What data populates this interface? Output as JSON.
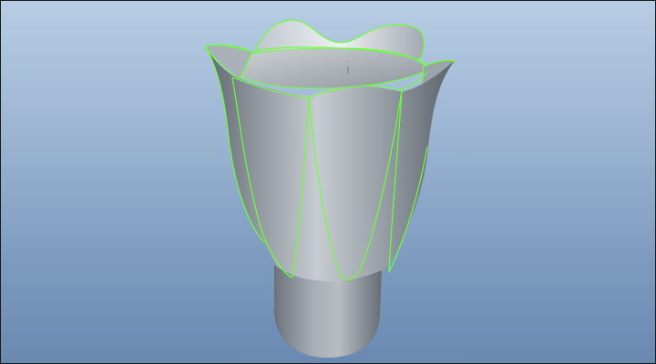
{
  "viewport": {
    "background_top": "#b7cde4",
    "background_bottom": "#6a89b1",
    "model": {
      "shape": "tulip-vase",
      "surface_color": "#9aa3ab",
      "edge_highlight_color": "#6cff3c"
    }
  }
}
